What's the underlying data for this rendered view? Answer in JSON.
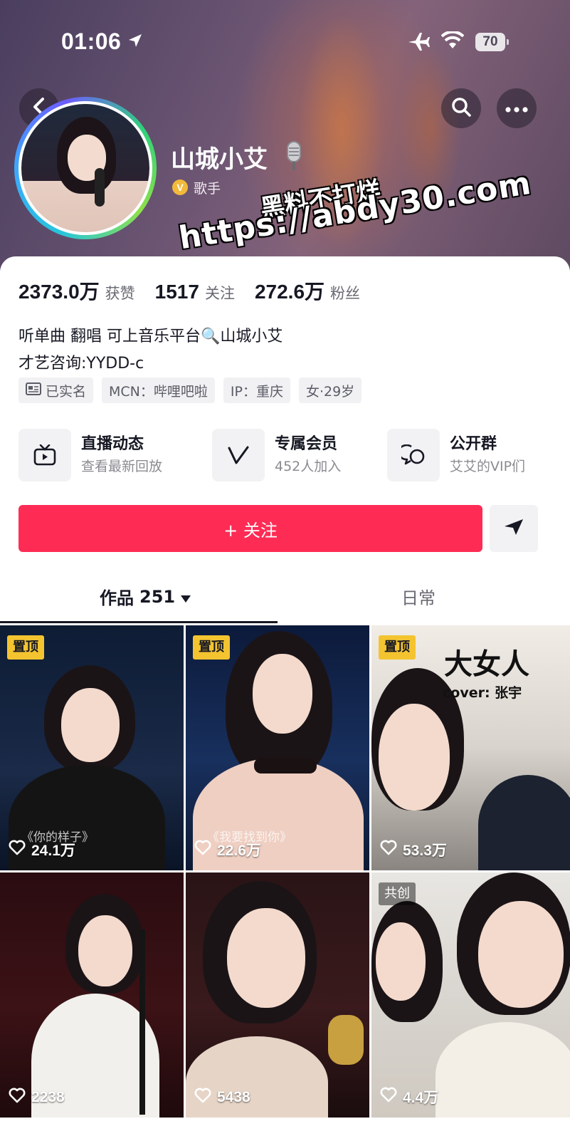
{
  "status_bar": {
    "time": "01:06",
    "battery": "70"
  },
  "profile": {
    "name": "山城小艾",
    "badge_letter": "V",
    "tag": "歌手"
  },
  "watermark": {
    "line1": "黑料不打烊",
    "line2": "https://abdy30.com"
  },
  "stats": {
    "likes_value": "2373.0万",
    "likes_label": "获赞",
    "following_value": "1517",
    "following_label": "关注",
    "followers_value": "272.6万",
    "followers_label": "粉丝"
  },
  "bio": {
    "line1": "听单曲 翻唱 可上音乐平台🔍山城小艾",
    "line2": "才艺咨询:YYDD-c"
  },
  "chips": {
    "verified": "已实名",
    "mcn": "MCN：哔哩吧啦",
    "ip": "IP：重庆",
    "gender_age": "女·29岁"
  },
  "features": [
    {
      "title": "直播动态",
      "sub": "查看最新回放"
    },
    {
      "title": "专属会员",
      "sub": "452人加入"
    },
    {
      "title": "公开群",
      "sub": "艾艾的VIP们"
    }
  ],
  "actions": {
    "follow_label": "+ 关注"
  },
  "tabs": {
    "works_label": "作品",
    "works_count": "251",
    "daily_label": "日常"
  },
  "videos": [
    {
      "badge": "置顶",
      "likes": "24.1万",
      "caption": "《你的样子》"
    },
    {
      "badge": "置顶",
      "likes": "22.6万",
      "caption": "《我要找到你》"
    },
    {
      "badge": "置顶",
      "likes": "53.3万",
      "overlay_title": "大女人",
      "overlay_sub": "cover: 张宇"
    },
    {
      "likes": "2238"
    },
    {
      "likes": "5438"
    },
    {
      "badge": "共创",
      "likes": "4.4万"
    }
  ],
  "colors": {
    "accent": "#fe2c55",
    "pin_badge": "#f4c430",
    "verified": "#f2b93a"
  }
}
